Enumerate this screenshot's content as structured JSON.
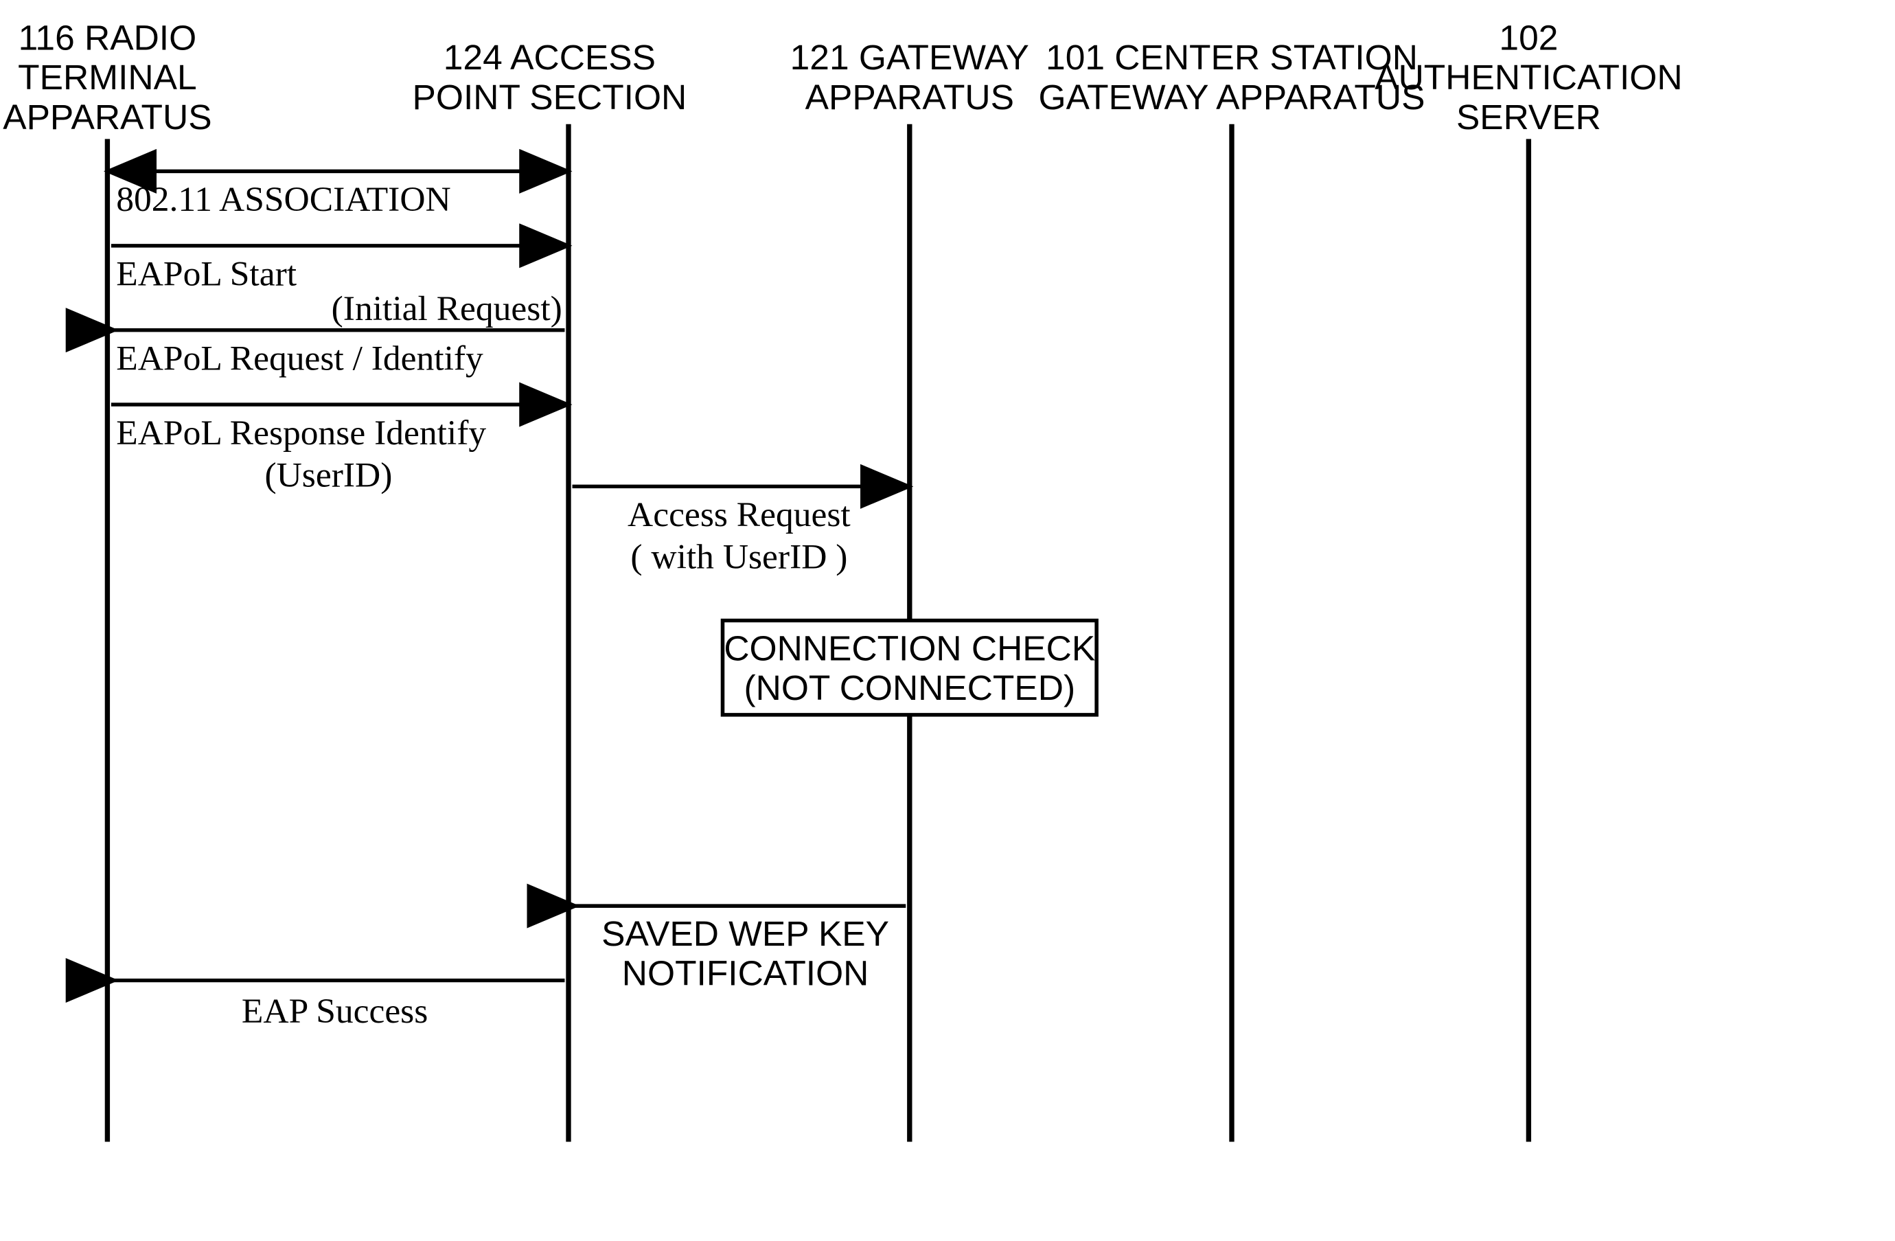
{
  "lifelines": {
    "l1": {
      "id_line1": "116  RADIO",
      "id_line2": "TERMINAL",
      "id_line3": "APPARATUS"
    },
    "l2": {
      "id_line1": "124  ACCESS",
      "id_line2": "POINT SECTION"
    },
    "l3": {
      "id_line1": "121  GATEWAY",
      "id_line2": "APPARATUS"
    },
    "l4": {
      "id_line1": "101  CENTER STATION",
      "id_line2": "GATEWAY APPARATUS"
    },
    "l5": {
      "id_line1": "102",
      "id_line2": "AUTHENTICATION",
      "id_line3": "SERVER"
    }
  },
  "messages": {
    "m1": {
      "label": "802.11  ASSOCIATION"
    },
    "m2": {
      "label": "EAPoL   Start",
      "sub": "(Initial Request)"
    },
    "m3": {
      "label": "EAPoL   Request / Identify"
    },
    "m4": {
      "label_l1": "EAPoL   Response Identify",
      "label_l2": "(UserID)"
    },
    "m5": {
      "label_l1": "Access Request",
      "label_l2": "( with UserID )"
    },
    "m6": {
      "label_l1": "SAVED WEP KEY",
      "label_l2": "NOTIFICATION"
    },
    "m7": {
      "label": "EAP Success"
    }
  },
  "box": {
    "line1": "CONNECTION CHECK",
    "line2": "(NOT CONNECTED)"
  }
}
